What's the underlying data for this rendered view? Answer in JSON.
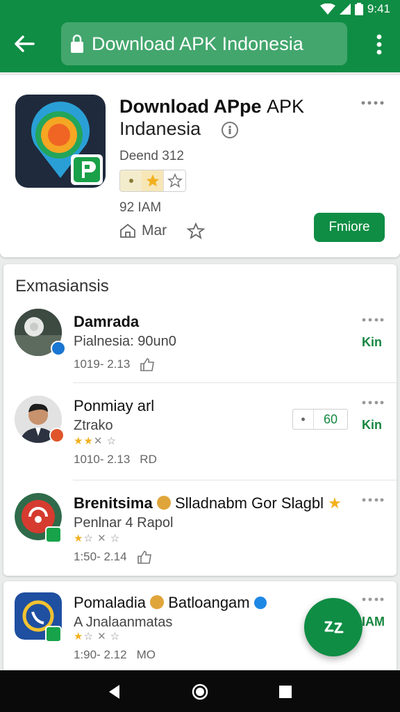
{
  "status_bar": {
    "time": "9:41"
  },
  "app_bar": {
    "search_text": "Download APK Indonesia"
  },
  "header": {
    "title_bold": "Download APpe",
    "title_thin": "APK",
    "title_line2": "Indanesia",
    "developer": "Deend 312",
    "size": "92 IAM",
    "meta_label": "Mar",
    "install_label": "Fmiore"
  },
  "section": {
    "title": "Exmasiansis"
  },
  "list": [
    {
      "name": "Damrada",
      "subtitle": "Pialnesia: 90un0",
      "date": "1019- 2.13",
      "action": "Kin"
    },
    {
      "name": "Ponmiay arl",
      "subtitle": "Ztrako",
      "date": "1010- 2.13",
      "date_suffix": "RD",
      "rating_value": "60",
      "action": "Kin"
    },
    {
      "name": "Brenitsima",
      "name_tail": "Slladnabm Gor Slagbl",
      "subtitle": "Penlnar 4 Rapol",
      "date": "1:50- 2.14"
    },
    {
      "name": "Pomaladia",
      "name_tail": "Batloangam",
      "subtitle": "A Jnalaanmatas",
      "date": "1:90- 2.12",
      "date_suffix": "MO",
      "action": "IAM"
    }
  ],
  "colors": {
    "brand_green": "#0f8d44",
    "accent_green": "#15863f",
    "star": "#f2b01e"
  }
}
